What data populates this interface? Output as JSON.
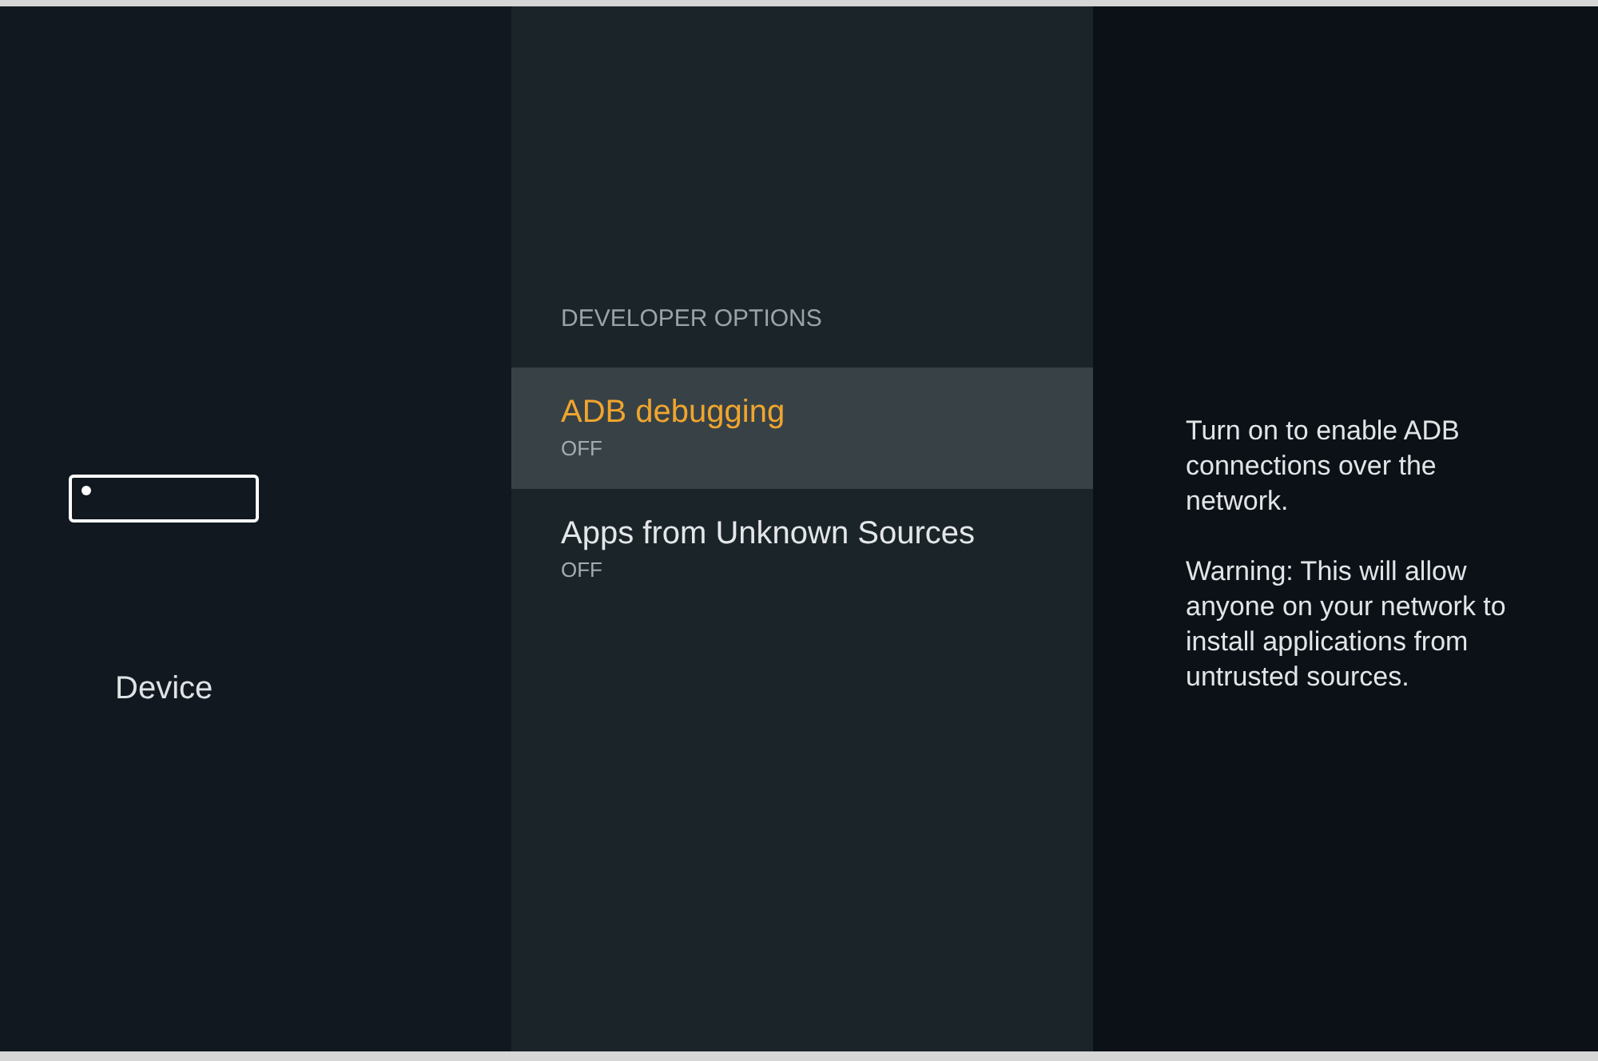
{
  "sidebar": {
    "label": "Device"
  },
  "section": {
    "heading": "DEVELOPER OPTIONS",
    "items": [
      {
        "title": "ADB debugging",
        "value": "OFF",
        "selected": true
      },
      {
        "title": "Apps from Unknown Sources",
        "value": "OFF",
        "selected": false
      }
    ]
  },
  "description": {
    "paragraphs": [
      "Turn on to enable ADB connections over the network.",
      "Warning: This will allow anyone on your network to install applications from untrusted sources."
    ]
  }
}
